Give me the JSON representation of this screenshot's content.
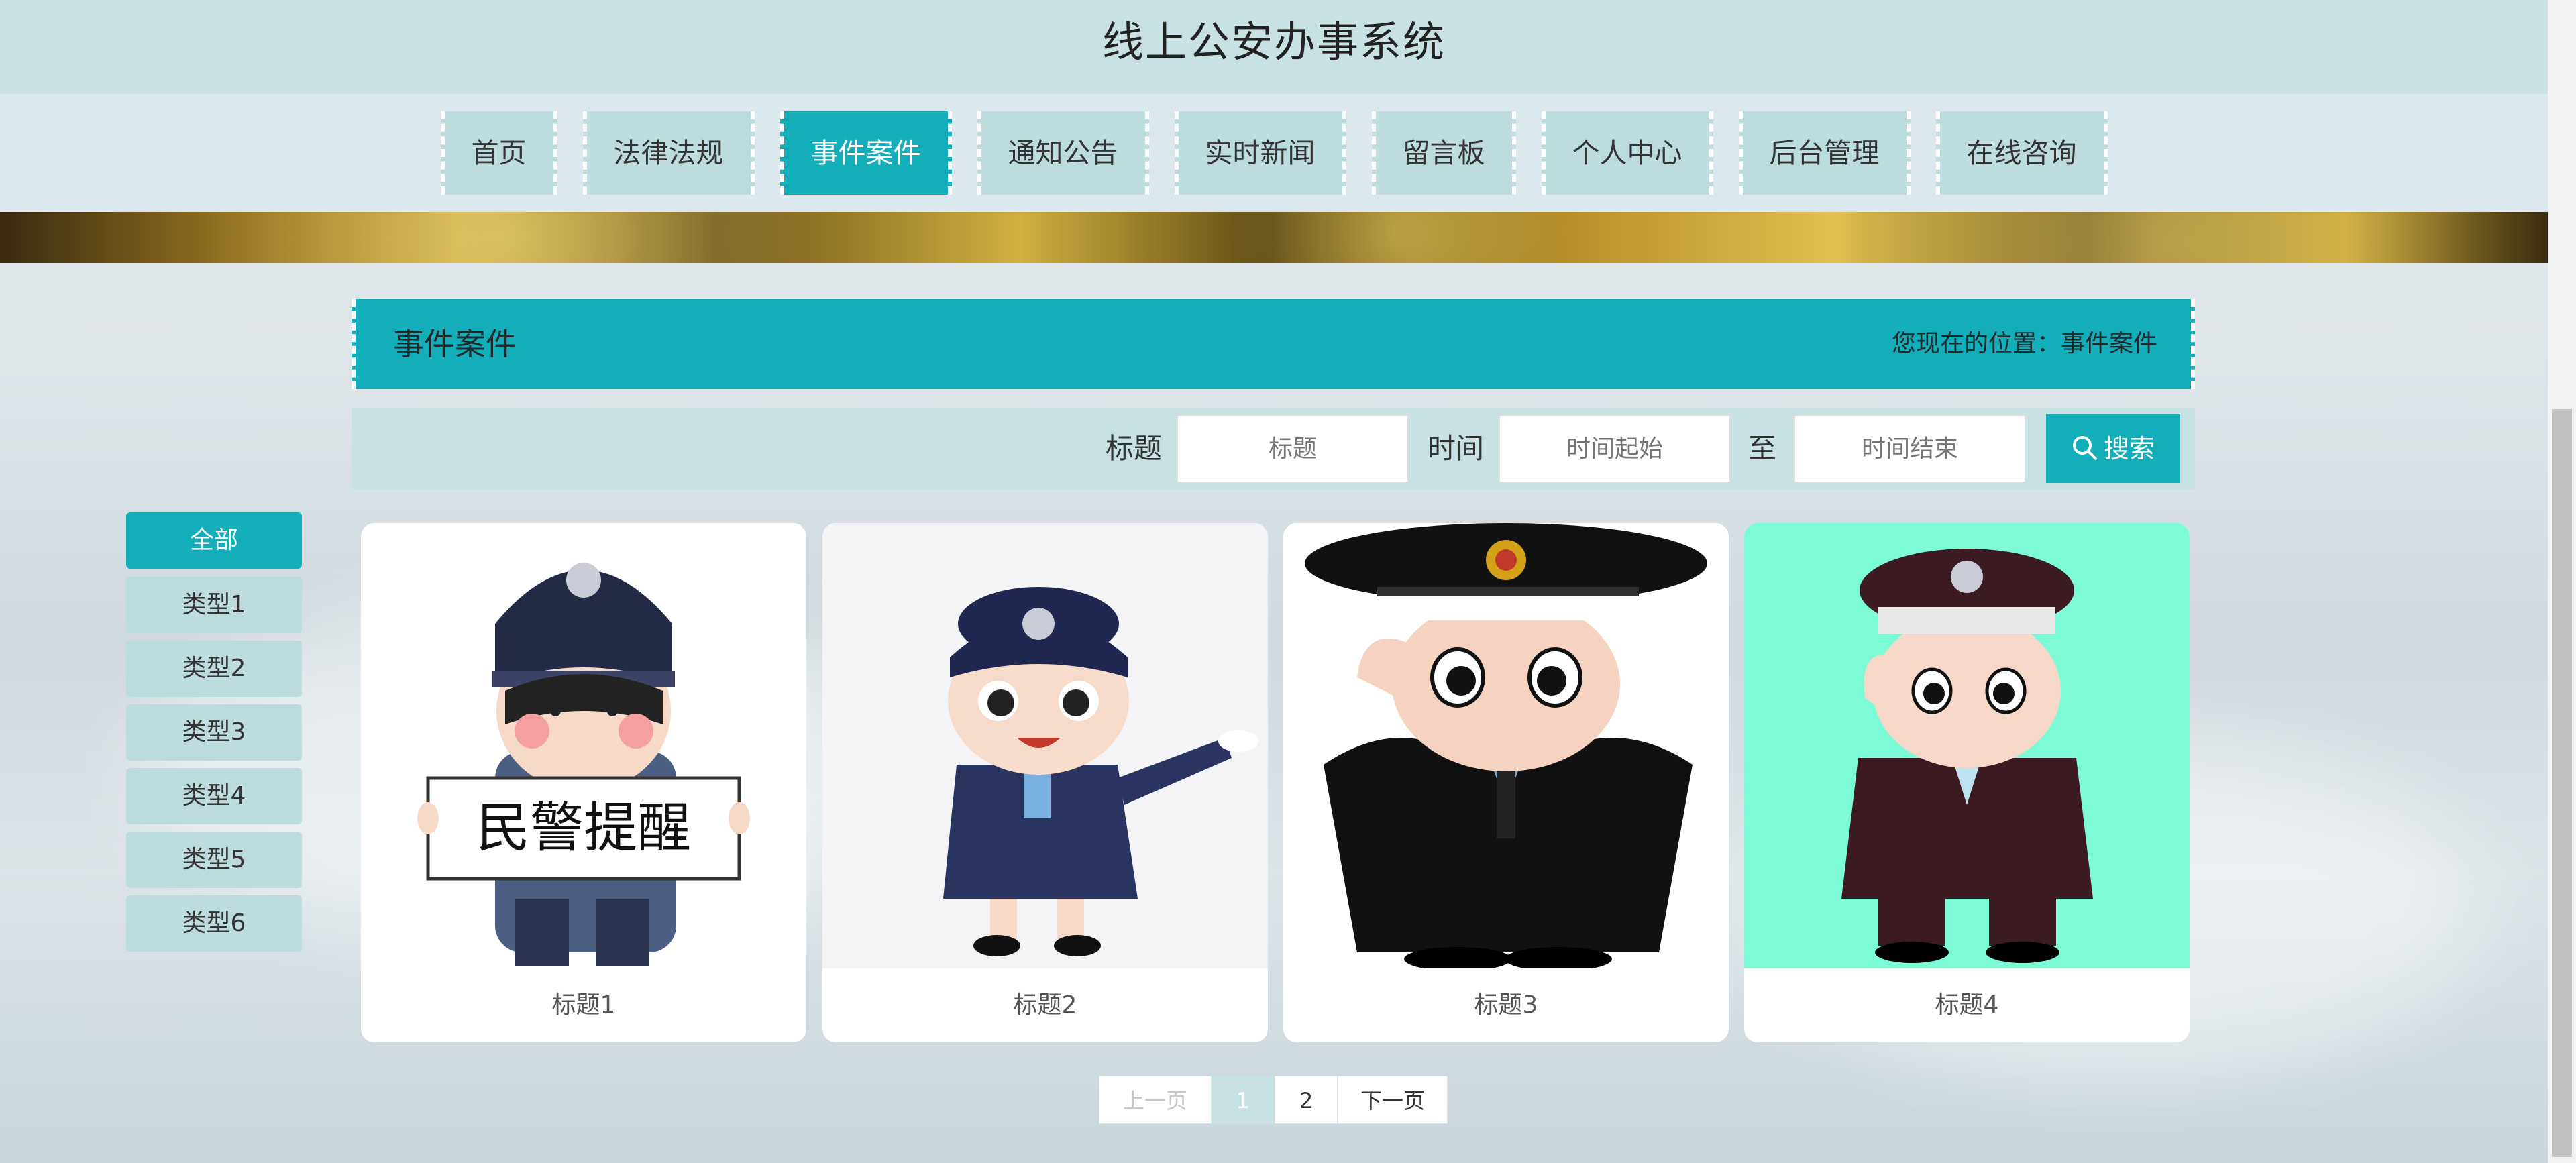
{
  "header": {
    "title": "线上公安办事系统"
  },
  "nav": [
    {
      "label": "首页",
      "active": false
    },
    {
      "label": "法律法规",
      "active": false
    },
    {
      "label": "事件案件",
      "active": true
    },
    {
      "label": "通知公告",
      "active": false
    },
    {
      "label": "实时新闻",
      "active": false
    },
    {
      "label": "留言板",
      "active": false
    },
    {
      "label": "个人中心",
      "active": false
    },
    {
      "label": "后台管理",
      "active": false
    },
    {
      "label": "在线咨询",
      "active": false
    }
  ],
  "section": {
    "title": "事件案件",
    "location": "您现在的位置：事件案件"
  },
  "search": {
    "title_label": "标题",
    "title_placeholder": "标题",
    "time_label": "时间",
    "start_placeholder": "时间起始",
    "to_label": "至",
    "end_placeholder": "时间结束",
    "button_label": "搜索"
  },
  "categories": [
    "全部",
    "类型1",
    "类型2",
    "类型3",
    "类型4",
    "类型5",
    "类型6"
  ],
  "cards": [
    {
      "caption": "标题1",
      "sign_text": "民警提醒"
    },
    {
      "caption": "标题2"
    },
    {
      "caption": "标题3"
    },
    {
      "caption": "标题4"
    }
  ],
  "pagination": {
    "prev": "上一页",
    "pages": [
      "1",
      "2"
    ],
    "current": "1",
    "next": "下一页"
  },
  "colors": {
    "accent": "#13aeb9",
    "header_bg": "#c8e2e4",
    "nav_inactive": "#bcdcdd",
    "card4_bg": "#7dfad6"
  }
}
